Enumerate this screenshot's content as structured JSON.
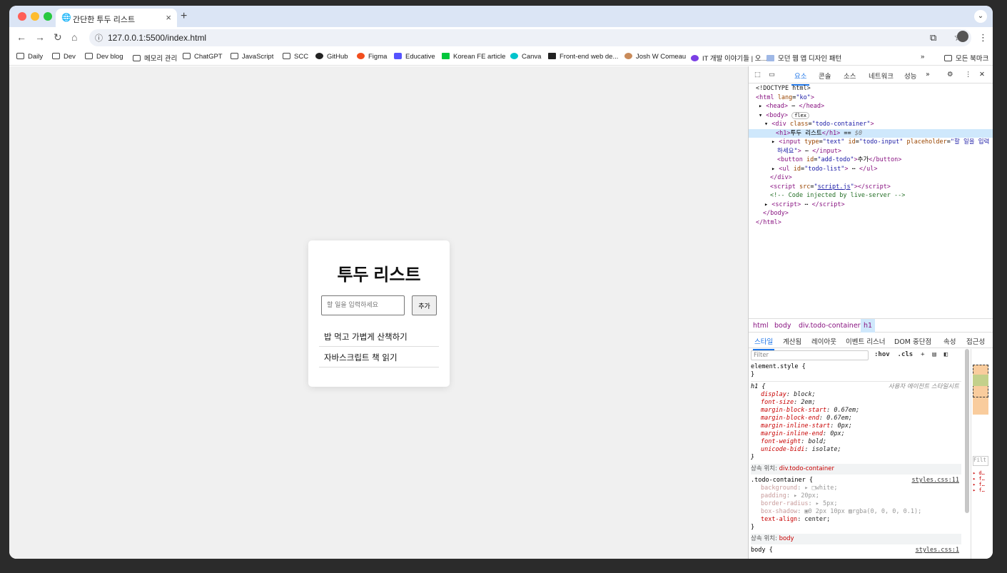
{
  "browser": {
    "tab_title": "간단한 투두 리스트",
    "url": "127.0.0.1:5500/index.html",
    "bookmarks": [
      "Daily",
      "Dev",
      "Dev blog",
      "메모리 관리",
      "ChatGPT",
      "JavaScript",
      "SCC",
      "GitHub",
      "Figma",
      "Educative",
      "Korean FE article",
      "Canva",
      "Front-end web de...",
      "Josh W Comeau",
      "IT 개발 이야기들 | 오...",
      "모던 웹 앱 디자인 패턴"
    ],
    "all_bookmarks": "모든 북마크"
  },
  "app": {
    "title": "투두 리스트",
    "input_placeholder": "할 일을 입력하세요",
    "add_label": "추가",
    "todos": [
      "밥 먹고 가볍게 산책하기",
      "자바스크립트 책 읽기"
    ]
  },
  "devtools": {
    "tabs": [
      "요소",
      "콘솔",
      "소스",
      "네트워크",
      "성능"
    ],
    "breadcrumbs": [
      "html",
      "body",
      "div.todo-container",
      "h1"
    ],
    "subtabs": [
      "스타일",
      "계산됨",
      "레이아웃",
      "이벤트 리스너",
      "DOM 중단점",
      "속성",
      "접근성"
    ],
    "filter_placeholder": "Filter",
    "hov": ":hov",
    "cls": ".cls",
    "ua_label": "사용자 에이전트 스타일시트",
    "inherited_from": "상속 위치:",
    "inherit_todo": "div.todo-container",
    "inherit_body": "body",
    "styles_src": "styles.css:11",
    "styles_src2": "styles.css:1"
  }
}
